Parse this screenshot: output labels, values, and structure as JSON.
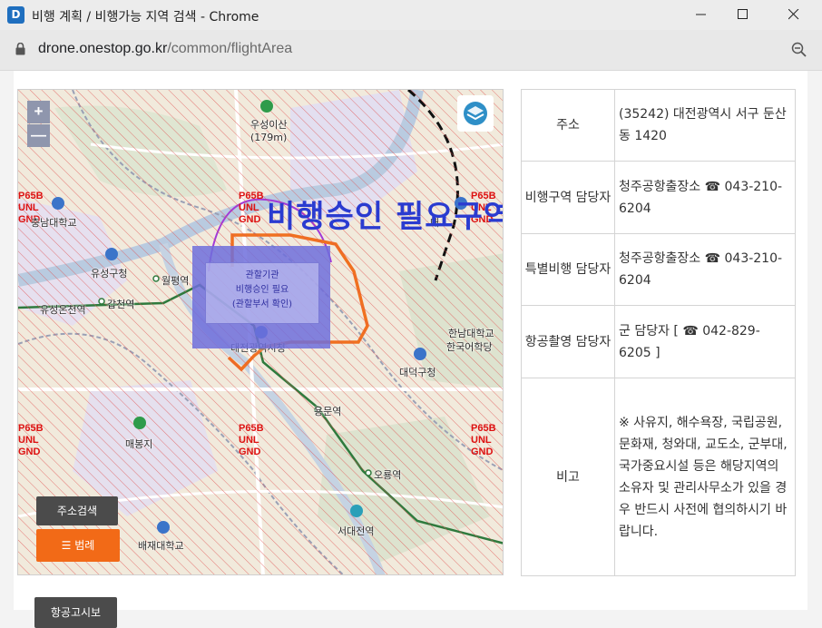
{
  "window": {
    "app_icon": "D",
    "title": "비행 계획 / 비행가능 지역 검색 - Chrome",
    "url_host": "drone.onestop.go.kr",
    "url_path": "/common/flightArea"
  },
  "map": {
    "zoom_in": "+",
    "zoom_out": "—",
    "warning": "비행승인 필요구역",
    "overlay": {
      "line1": "관할기관",
      "line2": "비행승인 필요",
      "line3": "(관할부서 확인)"
    },
    "zone_codes": [
      {
        "l1": "P65B",
        "l2": "UNL",
        "l3": "GND"
      },
      {
        "l1": "P65B",
        "l2": "UNL",
        "l3": "GND"
      },
      {
        "l1": "P65B",
        "l2": "UNL",
        "l3": "GND"
      },
      {
        "l1": "P65B",
        "l2": "UNL",
        "l3": "GND"
      },
      {
        "l1": "P65B",
        "l2": "UNL",
        "l3": "GND"
      },
      {
        "l1": "P65B",
        "l2": "UNL",
        "l3": "GND"
      }
    ],
    "labels": {
      "woosung": "우성이산",
      "height": "(179m)",
      "chungnam": "충남대학교",
      "yuseong_gu": "유성구청",
      "wolpyeong": "월평역",
      "yuseong_spa": "유성온천역",
      "gapcheon": "갑천역",
      "city_hall": "대전광역시청",
      "hannam": "한남대학교",
      "hanguk": "한국어학당",
      "daedeok": "대덕구청",
      "yongmun": "용문역",
      "maebong": "매봉지",
      "oryong": "오룡역",
      "seodae": "서대전역",
      "baejae": "배재대학교",
      "daebon": "대"
    },
    "address_search_button": "주소검색",
    "legend_button": "범례"
  },
  "notice_button": "항공고시보",
  "info_table": [
    {
      "header": "주소",
      "value": "(35242) 대전광역시 서구 둔산동 1420"
    },
    {
      "header": "비행구역 담당자",
      "value": "청주공항출장소 ☎ 043-210-6204"
    },
    {
      "header": "특별비행 담당자",
      "value": "청주공항출장소 ☎ 043-210-6204"
    },
    {
      "header": "항공촬영 담당자",
      "value": "군 담당자 [ ☎ 042-829-6205 ]"
    },
    {
      "header": "비고",
      "value": "※ 사유지, 해수욕장, 국립공원, 문화재, 청와대, 교도소, 군부대, 국가중요시설 등은 해당지역의 소유자 및 관리사무소가 있을 경우 반드시 사전에 협의하시기 바랍니다."
    }
  ],
  "colors": {
    "warning_text": "#2a3bd0",
    "zone_label": "#dd1111",
    "legend_button": "#f26a17",
    "route": "#f07020"
  }
}
